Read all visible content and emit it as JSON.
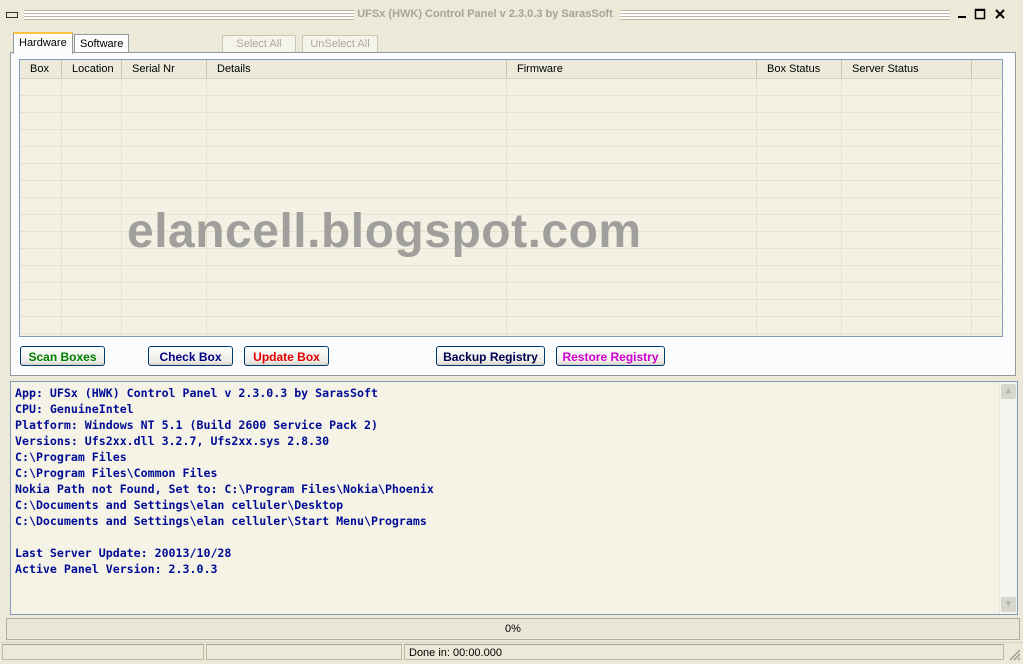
{
  "window": {
    "title": "UFSx (HWK) Control Panel v 2.3.0.3 by SarasSoft",
    "minimize_icon": "minimize-icon",
    "maximize_icon": "maximize-icon",
    "close_icon": "close-icon"
  },
  "tabs": [
    {
      "label": "Hardware",
      "active": true
    },
    {
      "label": "Software",
      "active": false
    }
  ],
  "toolbar": {
    "select_all": "Select All",
    "unselect_all": "UnSelect All"
  },
  "grid": {
    "columns": [
      "Box",
      "Location",
      "Serial Nr",
      "Details",
      "Firmware",
      "Box Status",
      "Server Status"
    ],
    "rows": []
  },
  "watermark": "elancell.blogspot.com",
  "actions": {
    "scan_boxes": {
      "label": "Scan Boxes",
      "color": "#008000"
    },
    "check_box": {
      "label": "Check Box",
      "color": "#000080"
    },
    "update_box": {
      "label": "Update Box",
      "color": "#e00000"
    },
    "backup_registry": {
      "label": "Backup Registry",
      "color": "#000050"
    },
    "restore_registry": {
      "label": "Restore Registry",
      "color": "#d000d0"
    }
  },
  "log": {
    "lines": [
      "App: UFSx (HWK) Control Panel v 2.3.0.3 by SarasSoft",
      "CPU: GenuineIntel",
      "Platform: Windows NT 5.1 (Build 2600 Service Pack 2)",
      "Versions: Ufs2xx.dll 3.2.7, Ufs2xx.sys 2.8.30",
      "C:\\Program Files",
      "C:\\Program Files\\Common Files",
      "Nokia Path not Found, Set to: C:\\Program Files\\Nokia\\Phoenix",
      "C:\\Documents and Settings\\elan celluler\\Desktop",
      "C:\\Documents and Settings\\elan celluler\\Start Menu\\Programs",
      "",
      "Last Server Update: 20013/10/28",
      "Active Panel Version: 2.3.0.3"
    ]
  },
  "progress": {
    "label": "0%",
    "value": 0
  },
  "status": {
    "cell1": "",
    "cell2": "",
    "done_in": "Done in: 00:00.000"
  }
}
